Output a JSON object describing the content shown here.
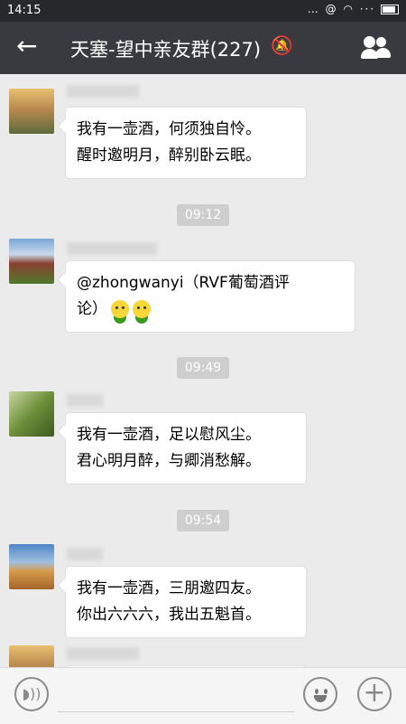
{
  "status_bar": {
    "time": "14:15",
    "icons_text": "… @ ◠ ···"
  },
  "header": {
    "back_icon": "arrow-left-icon",
    "title": "天塞-望中亲友群(227)",
    "mute_icon": "bell-off-icon",
    "group_icon": "group-members-icon"
  },
  "messages": [
    {
      "avatar": "sunset-portrait-avatar",
      "lines": [
        "我有一壶酒，何须独自怜。",
        "醒时邀明月，醉别卧云眠。"
      ]
    },
    {
      "avatar": "vineyard-avatar",
      "lines": [
        "@zhongwanyi（RVF葡萄酒评",
        "论）"
      ],
      "emoji_icon": "green-smiley-emoji-icon"
    },
    {
      "avatar": "bamboo-avatar",
      "lines": [
        "我有一壶酒，足以慰风尘。",
        "君心明月醉，与卿消愁解。"
      ]
    },
    {
      "avatar": "desert-person-avatar",
      "lines": [
        "我有一壶酒，三朋邀四友。",
        "你出六六六，我出五魁首。"
      ]
    }
  ],
  "timestamps": [
    "09:12",
    "09:49",
    "09:54"
  ],
  "input_bar": {
    "voice_icon": "voice-input-icon",
    "emoji_icon": "smiley-face-icon",
    "plus_icon": "plus-icon"
  }
}
